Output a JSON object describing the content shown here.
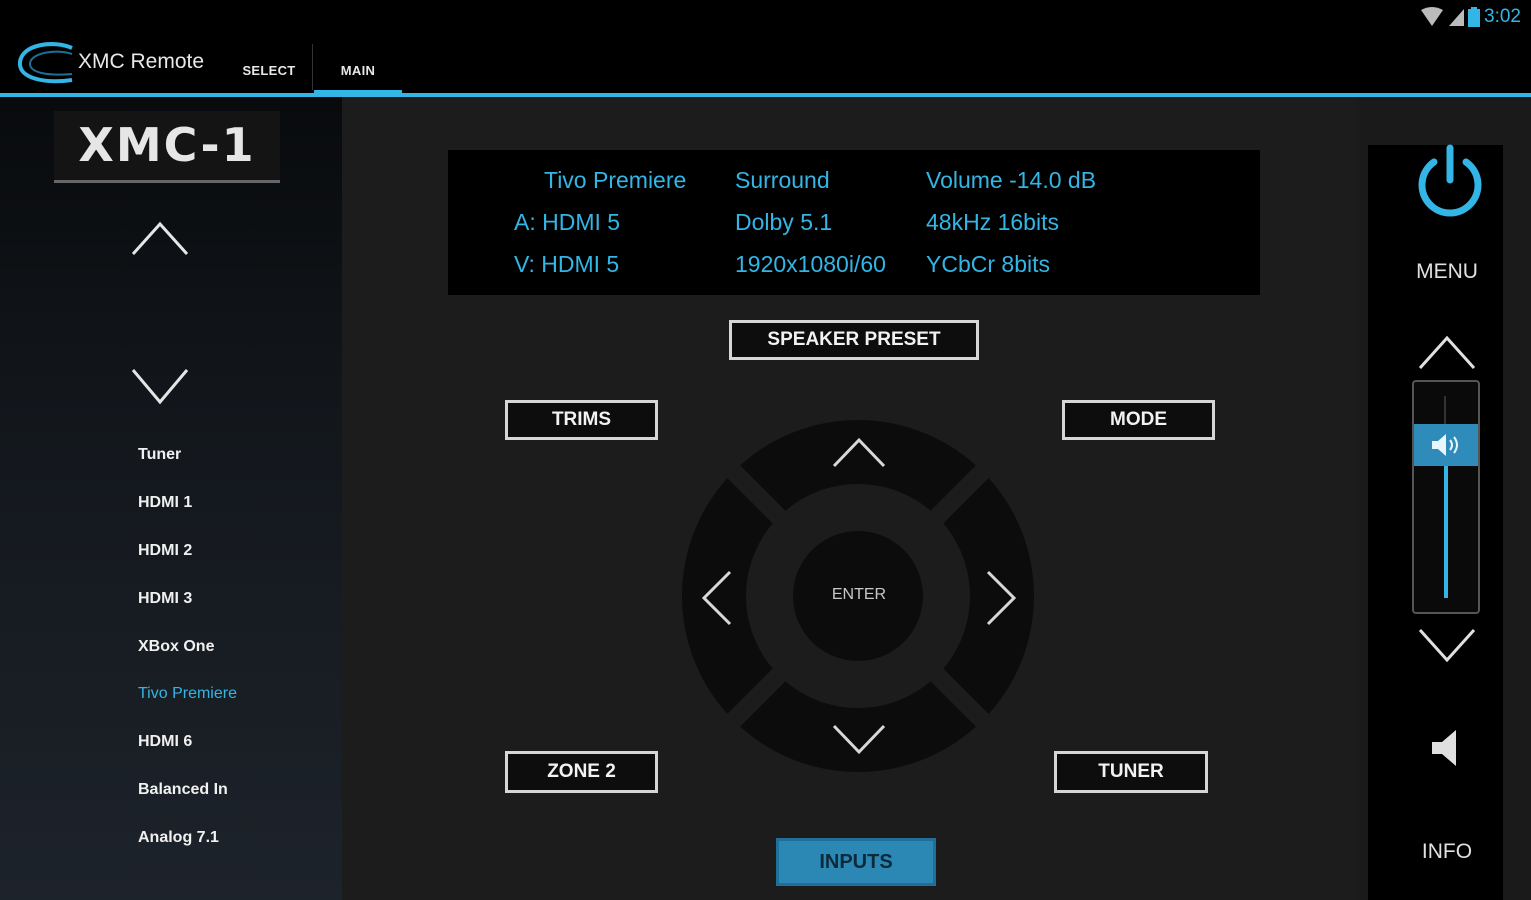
{
  "status_bar": {
    "time": "3:02"
  },
  "action_bar": {
    "title": "XMC Remote",
    "tabs": [
      {
        "label": "SELECT"
      },
      {
        "label": "MAIN"
      }
    ],
    "accent": "#33b5e5"
  },
  "sidebar": {
    "brand": "XMC-1",
    "inputs": [
      {
        "label": "Tuner"
      },
      {
        "label": "HDMI 1"
      },
      {
        "label": "HDMI 2"
      },
      {
        "label": "HDMI 3"
      },
      {
        "label": "XBox One"
      },
      {
        "label": "Tivo Premiere"
      },
      {
        "label": "HDMI 6"
      },
      {
        "label": "Balanced In"
      },
      {
        "label": "Analog 7.1"
      }
    ],
    "active_input": "Tivo Premiere"
  },
  "info": {
    "source": "Tivo Premiere",
    "surround": "Surround",
    "volume": "Volume -14.0 dB",
    "audio_input": "A: HDMI 5",
    "audio_format": "Dolby 5.1",
    "audio_rate": "48kHz 16bits",
    "video_input": "V: HDMI 5",
    "video_resolution": "1920x1080i/60",
    "video_format": "YCbCr 8bits"
  },
  "buttons": {
    "speaker_preset": "SPEAKER PRESET",
    "trims": "TRIMS",
    "mode": "MODE",
    "zone2": "ZONE 2",
    "tuner": "TUNER",
    "inputs": "INPUTS",
    "enter": "ENTER"
  },
  "right_panel": {
    "menu": "MENU",
    "info": "INFO",
    "icons": [
      "power-icon",
      "volume-up-icon",
      "volume-down-icon",
      "mute-icon"
    ]
  }
}
